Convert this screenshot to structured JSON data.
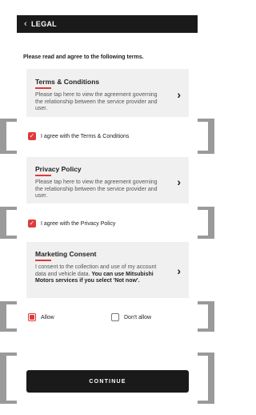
{
  "header": {
    "back_icon": "chevron-left-icon",
    "title": "LEGAL"
  },
  "intro": "Please read and agree to the following terms.",
  "terms": {
    "title": "Terms & Conditions",
    "desc": "Please tap here to view the agreement governing the relationship between the service provider and user.",
    "agree_label": "I agree with the Terms & Conditions",
    "checked": true
  },
  "privacy": {
    "title": "Privacy Policy",
    "desc": "Please tap here to view the agreement governing the relationship between the service provider and user.",
    "agree_label": "I agree with the Privacy Policy",
    "checked": true
  },
  "marketing": {
    "title": "Marketing Consent",
    "desc_plain": "I consent to the collection and use of my account data and vehicle data. ",
    "desc_bold": "You can use Mitsubishi Motors services if you select 'Not now'.",
    "allow_label": "Allow",
    "dont_allow_label": "Don't allow",
    "selected": "allow"
  },
  "continue_label": "CONTINUE",
  "colors": {
    "accent": "#e03a3a",
    "dark": "#1a1a1a",
    "card": "#f0f0f0"
  }
}
